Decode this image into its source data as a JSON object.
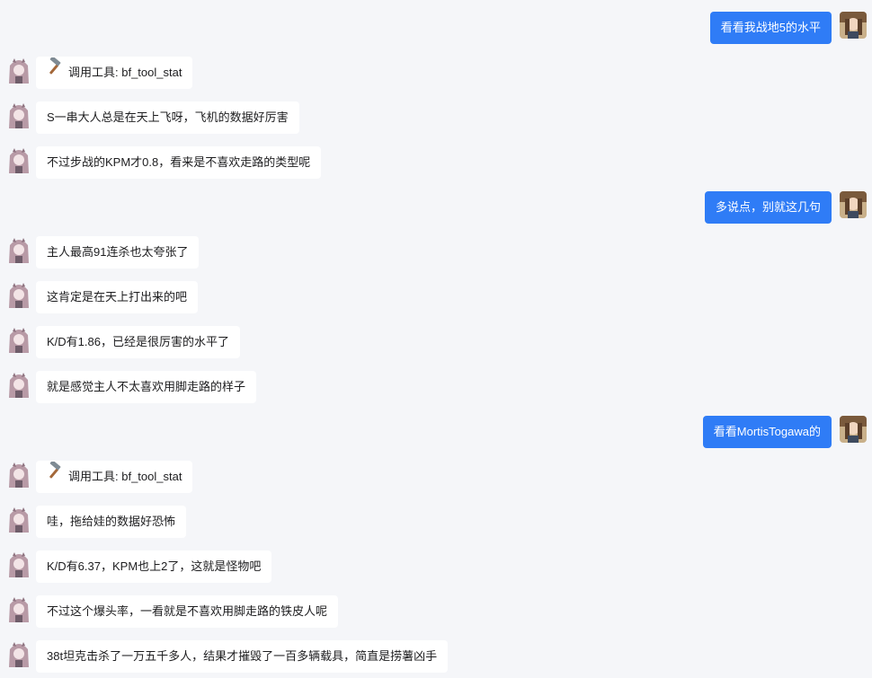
{
  "messages": [
    {
      "role": "user",
      "text": "看看我战地5的水平"
    },
    {
      "role": "bot",
      "tool": true,
      "icon": "hammer-icon",
      "text": "调用工具: bf_tool_stat"
    },
    {
      "role": "bot",
      "text": "S一串大人总是在天上飞呀，飞机的数据好厉害"
    },
    {
      "role": "bot",
      "text": "不过步战的KPM才0.8，看来是不喜欢走路的类型呢"
    },
    {
      "role": "user",
      "text": "多说点，别就这几句"
    },
    {
      "role": "bot",
      "text": "主人最高91连杀也太夸张了"
    },
    {
      "role": "bot",
      "text": "这肯定是在天上打出来的吧"
    },
    {
      "role": "bot",
      "text": "K/D有1.86，已经是很厉害的水平了"
    },
    {
      "role": "bot",
      "text": "就是感觉主人不太喜欢用脚走路的样子"
    },
    {
      "role": "user",
      "text": "看看MortisTogawa的"
    },
    {
      "role": "bot",
      "tool": true,
      "icon": "hammer-icon",
      "text": "调用工具: bf_tool_stat"
    },
    {
      "role": "bot",
      "text": "哇，拖给娃的数据好恐怖"
    },
    {
      "role": "bot",
      "text": "K/D有6.37，KPM也上2了，这就是怪物吧"
    },
    {
      "role": "bot",
      "text": "不过这个爆头率，一看就是不喜欢用脚走路的铁皮人呢"
    },
    {
      "role": "bot",
      "text": "38t坦克击杀了一万五千多人，结果才摧毁了一百多辆载具，简直是捞薯凶手"
    }
  ],
  "colors": {
    "page_background": "#f5f6f9",
    "bot_bubble": "#ffffff",
    "user_bubble": "#2f7cf6",
    "user_text": "#ffffff"
  }
}
